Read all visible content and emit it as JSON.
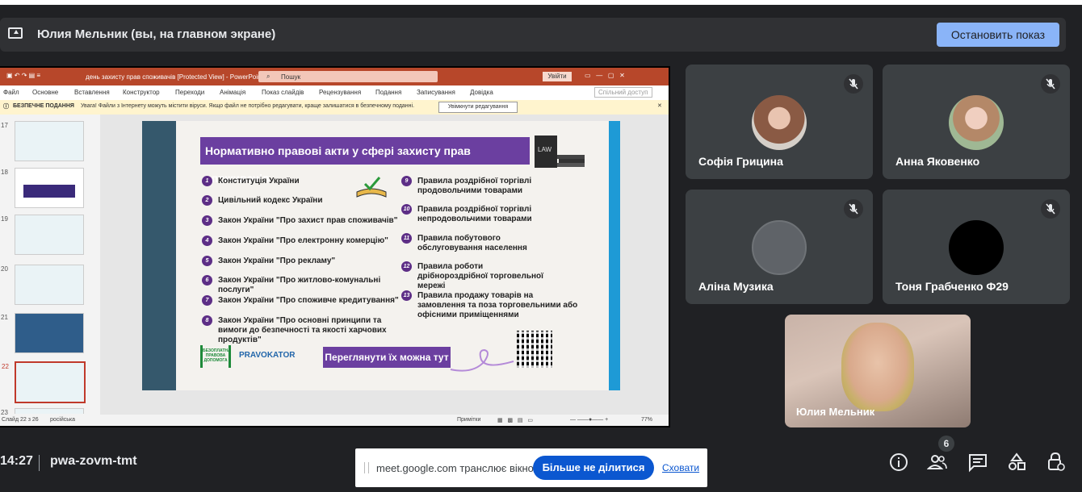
{
  "presenter_bar": {
    "title": "Юлия Мельник (вы, на главном экране)",
    "stop_button": "Остановить показ"
  },
  "ppt": {
    "window_title": "день захисту прав споживачів [Protected View] - PowerPoint",
    "search": "Пошук",
    "login": "Увійти",
    "share": "Спільний доступ",
    "menu": [
      "Файл",
      "Основне",
      "Вставлення",
      "Конструктор",
      "Переходи",
      "Анімація",
      "Показ слайдів",
      "Рецензування",
      "Подання",
      "Записування",
      "Довідка"
    ],
    "warning_label": "БЕЗПЕЧНЕ ПОДАННЯ",
    "warning_text": "Увага! Файли з Інтернету можуть містити віруси. Якщо файл не потрібно редагувати, краще залишатися в безпечному поданні.",
    "warning_button": "Увімкнути редагування",
    "thumb_numbers": [
      "17",
      "18",
      "19",
      "20",
      "21",
      "22",
      "23"
    ],
    "status_slide": "Слайд 22 з 26",
    "status_lang": "російська",
    "status_notes": "Примітки",
    "status_zoom": "77%",
    "slide": {
      "heading": "Нормативно правові акти у сфері захисту прав споживачів",
      "left_items": [
        {
          "n": "1",
          "text": "Конституція України"
        },
        {
          "n": "2",
          "text": "Цивільний кодекс України"
        },
        {
          "n": "3",
          "text": "Закон України \"Про захист прав споживачів\""
        },
        {
          "n": "4",
          "text": "Закон України \"Про електронну комерцію\""
        },
        {
          "n": "5",
          "text": "Закон України \"Про рекламу\""
        },
        {
          "n": "6",
          "text": "Закон України \"Про житлово-комунальні послуги\""
        },
        {
          "n": "7",
          "text": "Закон України \"Про споживче кредитування\""
        },
        {
          "n": "8",
          "text": "Закон України \"Про основні принципи та вимоги до безпечності та якості харчових продуктів\""
        }
      ],
      "right_items": [
        {
          "n": "9",
          "text": "Правила роздрібної торгівлі продовольчими товарами"
        },
        {
          "n": "10",
          "text": "Правила роздрібної торгівлі непродовольчими товарами"
        },
        {
          "n": "11",
          "text": "Правила побутового обслуговування населення"
        },
        {
          "n": "12",
          "text": "Правила роботи дрібнороздрібної торговельної мережі"
        },
        {
          "n": "13",
          "text": "Правила продажу товарів на замовлення та поза торговельними або офісними приміщеннями"
        }
      ],
      "button": "Переглянути їх можна тут",
      "logo1": "БЕЗОПЛАТНА ПРАВОВА ДОПОМОГА",
      "logo2": "PRAVOKATOR",
      "book_label": "LAW"
    }
  },
  "participants": [
    {
      "name": "Софія Грицина"
    },
    {
      "name": "Анна Яковенко"
    },
    {
      "name": "Аліна Музика"
    },
    {
      "name": "Тоня Грабченко Ф29"
    }
  ],
  "self_tile": {
    "name": "Юлия Мельник"
  },
  "bottom": {
    "time": "14:27",
    "meeting_code": "pwa-zovm-tmt",
    "people_count": "6"
  },
  "toast": {
    "message": "meet.google.com транслює вікно.",
    "stop_sharing": "Більше не ділитися",
    "hide": "Сховати"
  },
  "icons": [
    "screen-share-icon",
    "mic-off-icon",
    "info-icon",
    "people-icon",
    "chat-icon",
    "activities-icon",
    "host-controls-icon"
  ]
}
